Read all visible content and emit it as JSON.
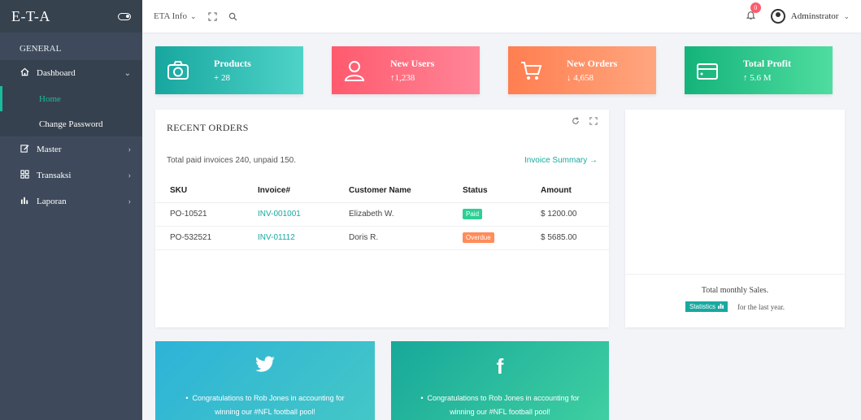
{
  "sidebar": {
    "brand": "E-T-A",
    "section": "GENERAL",
    "items": [
      {
        "label": "Dashboard",
        "icon": "home-icon"
      },
      {
        "label": "Master",
        "icon": "edit-icon"
      },
      {
        "label": "Transaksi",
        "icon": "grid-icon"
      },
      {
        "label": "Laporan",
        "icon": "bar-chart-icon"
      }
    ],
    "subitems": [
      {
        "label": "Home"
      },
      {
        "label": "Change Password"
      }
    ]
  },
  "topbar": {
    "menu": "ETA Info",
    "notifications": "0",
    "user": "Adminstrator"
  },
  "tiles": [
    {
      "name": "Products",
      "value": "+ 28",
      "icon": "camera-icon",
      "colors": [
        "#17a79f",
        "#4fd3c8"
      ]
    },
    {
      "name": "New Users",
      "value": "↑1,238",
      "icon": "user-icon",
      "colors": [
        "#ff5a6e",
        "#ff8597"
      ]
    },
    {
      "name": "New Orders",
      "value": "↓ 4,658",
      "icon": "cart-icon",
      "colors": [
        "#ff7e50",
        "#ffa67f"
      ]
    },
    {
      "name": "Total Profit",
      "value": "↑ 5.6 M",
      "icon": "wallet-icon",
      "colors": [
        "#14b37a",
        "#4fdda0"
      ]
    }
  ],
  "orders": {
    "title": "RECENT ORDERS",
    "summary": "Total paid invoices 240, unpaid 150.",
    "link": "Invoice Summary →",
    "headers": [
      "SKU",
      "Invoice#",
      "Customer Name",
      "Status",
      "Amount"
    ],
    "rows": [
      {
        "sku": "PO-10521",
        "invoice": "INV-001001",
        "customer": "Elizabeth W.",
        "status": "Paid",
        "amount": "$ 1200.00"
      },
      {
        "sku": "PO-532521",
        "invoice": "INV-01112",
        "customer": "Doris R.",
        "status": "Overdue",
        "amount": "$ 5685.00"
      }
    ]
  },
  "sales": {
    "caption": "Total monthly Sales.",
    "button": "Statistics",
    "suffix": "for the last year."
  },
  "social": [
    {
      "icon": "twitter-icon",
      "line1": "Congratulations to Rob Jones in accounting for",
      "line2": "winning our #NFL football pool!"
    },
    {
      "icon": "facebook-icon",
      "line1": "Congratulations to Rob Jones in accounting for",
      "line2": "winning our #NFL football pool!"
    }
  ],
  "colors": {
    "accent": "#1abc9c",
    "paid": "#2dcf95",
    "overdue": "#ff8c5a",
    "sidebar": "#3e4a5b"
  }
}
